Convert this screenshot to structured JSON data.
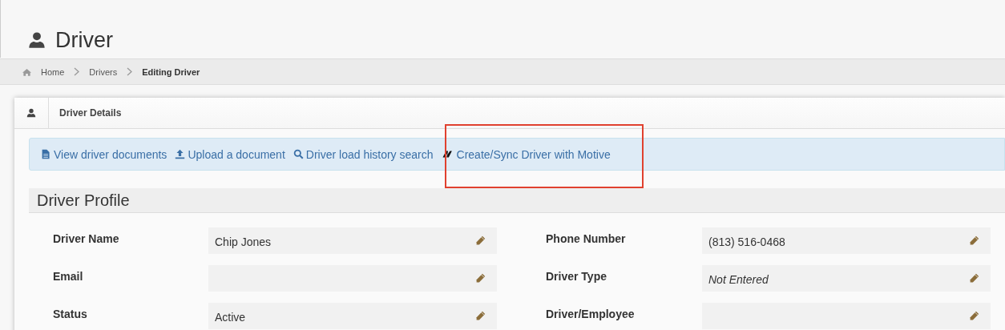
{
  "page_title": "Driver",
  "breadcrumb": [
    {
      "label": "Home",
      "current": false
    },
    {
      "label": "Drivers",
      "current": false
    },
    {
      "label": "Editing Driver",
      "current": true
    }
  ],
  "panel": {
    "title": "Driver Details"
  },
  "actions": [
    {
      "label": "View driver documents",
      "kind": "document"
    },
    {
      "label": "Upload a document",
      "kind": "upload"
    },
    {
      "label": "Driver load history search",
      "kind": "search"
    },
    {
      "label": "Create/Sync Driver with Motive",
      "kind": "motive"
    }
  ],
  "section": {
    "title": "Driver Profile"
  },
  "fields": [
    {
      "label": "Driver Name",
      "value": "Chip Jones"
    },
    {
      "label": "Phone Number",
      "value": "(813) 516-0468"
    },
    {
      "label": "Email"
    },
    {
      "label": "Driver Type",
      "placeholder": "Not Entered"
    },
    {
      "label": "Status",
      "value": "Active"
    },
    {
      "label": "Driver/Employee"
    }
  ]
}
